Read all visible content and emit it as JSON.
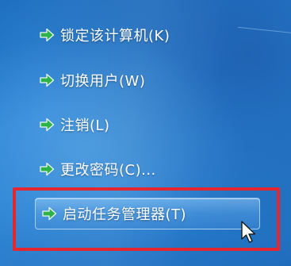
{
  "menu": {
    "items": [
      {
        "label": "锁定该计算机(K)",
        "icon": "green-arrow-icon"
      },
      {
        "label": "切换用户(W)",
        "icon": "green-arrow-icon"
      },
      {
        "label": "注销(L)",
        "icon": "green-arrow-icon"
      },
      {
        "label": "更改密码(C)...",
        "icon": "green-arrow-icon"
      },
      {
        "label": "启动任务管理器(T)",
        "icon": "green-arrow-icon",
        "hovered": true
      }
    ]
  },
  "colors": {
    "background": "#2a82d2",
    "text": "#ffffff",
    "arrow": "#2fb24a",
    "highlight_border": "#e6262e",
    "hover_fill": "#7fbff0"
  },
  "cursor": {
    "icon": "mouse-pointer-icon"
  }
}
